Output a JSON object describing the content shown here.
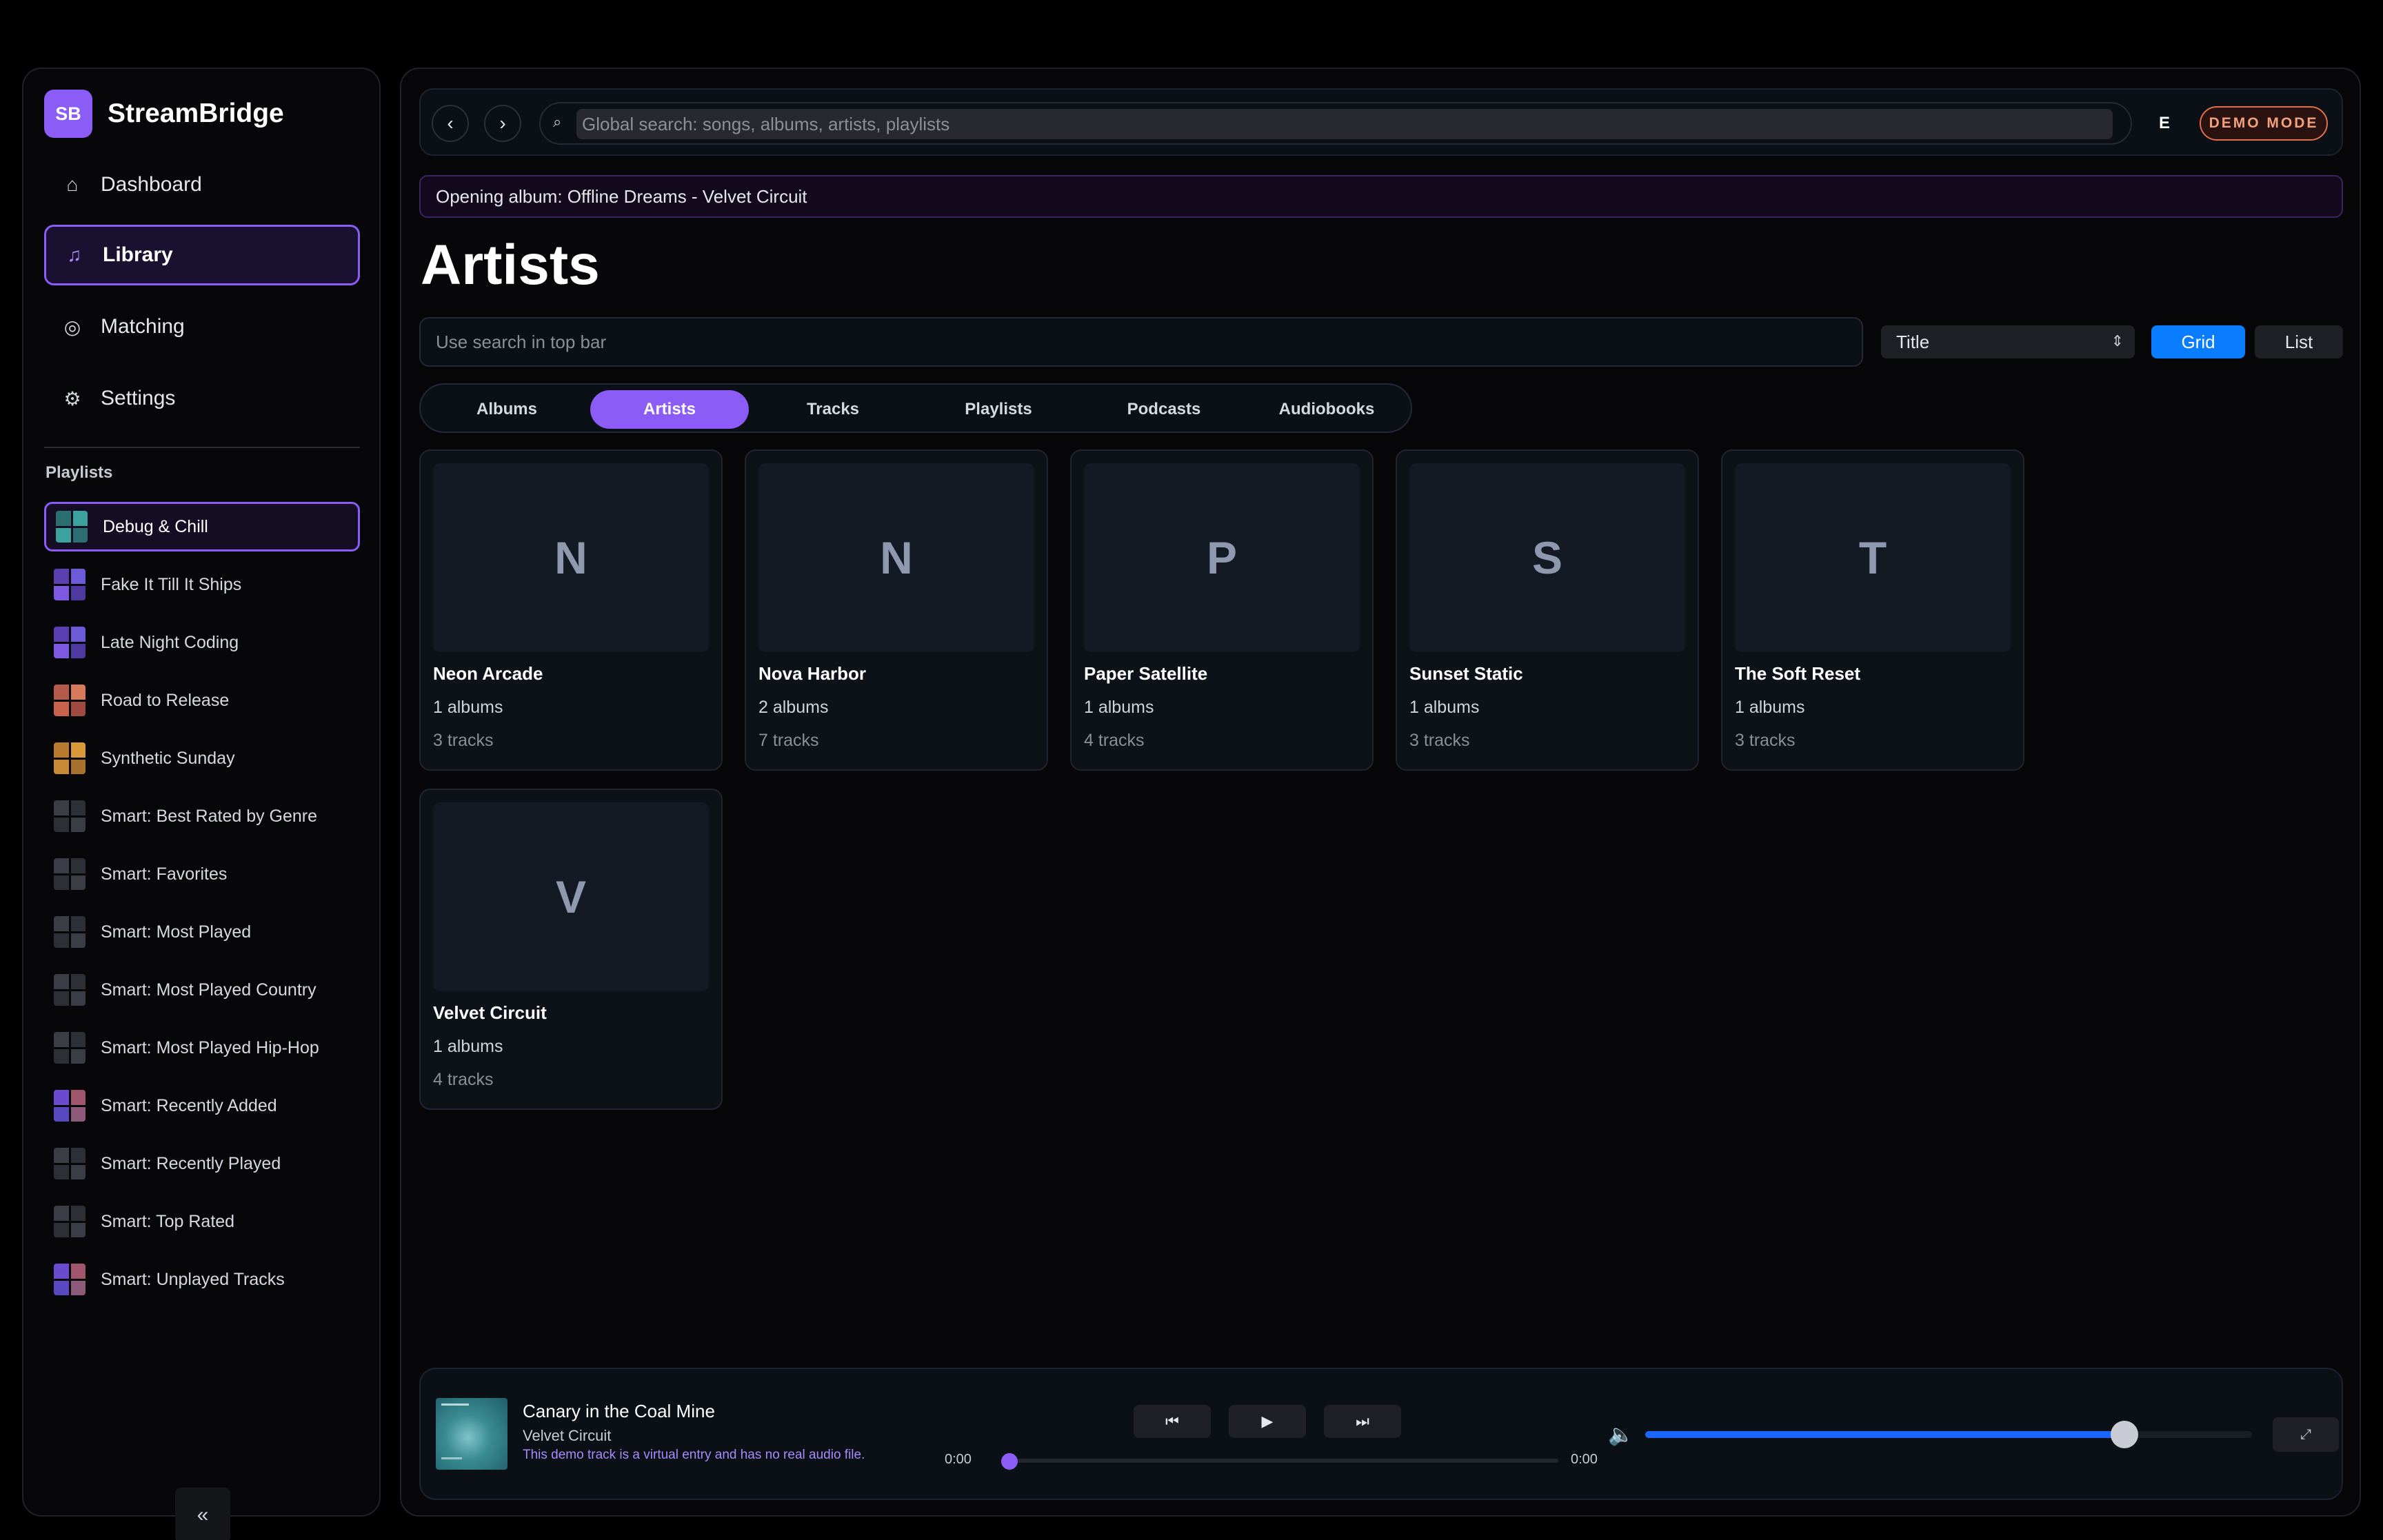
{
  "app": {
    "badge": "SB",
    "name": "StreamBridge"
  },
  "nav": [
    {
      "label": "Dashboard",
      "icon": "home-icon",
      "glyph": "⌂"
    },
    {
      "label": "Library",
      "icon": "music-note-icon",
      "glyph": "♫"
    },
    {
      "label": "Matching",
      "icon": "target-icon",
      "glyph": "◎"
    },
    {
      "label": "Settings",
      "icon": "gear-icon",
      "glyph": "⚙"
    }
  ],
  "playlists_heading": "Playlists",
  "playlists": [
    {
      "label": "Debug & Chill",
      "thumb": "teal"
    },
    {
      "label": "Fake It Till It Ships",
      "thumb": "purple"
    },
    {
      "label": "Late Night Coding",
      "thumb": "purple"
    },
    {
      "label": "Road to Release",
      "thumb": "red"
    },
    {
      "label": "Synthetic Sunday",
      "thumb": "orange"
    },
    {
      "label": "Smart: Best Rated by Genre",
      "thumb": "gray"
    },
    {
      "label": "Smart: Favorites",
      "thumb": "gray"
    },
    {
      "label": "Smart: Most Played",
      "thumb": "gray"
    },
    {
      "label": "Smart: Most Played Country",
      "thumb": "gray"
    },
    {
      "label": "Smart: Most Played Hip-Hop",
      "thumb": "gray"
    },
    {
      "label": "Smart: Recently Added",
      "thumb": "mix"
    },
    {
      "label": "Smart: Recently Played",
      "thumb": "gray"
    },
    {
      "label": "Smart: Top Rated",
      "thumb": "gray"
    },
    {
      "label": "Smart: Unplayed Tracks",
      "thumb": "mix"
    }
  ],
  "sidebar_collapse": "«",
  "topbar": {
    "back": "‹",
    "forward": "›",
    "search_icon": "⌕",
    "search_placeholder": "Global search: songs, albums, artists, playlists",
    "avatar": "E",
    "demo_badge": "DEMO MODE"
  },
  "notice": "Opening album: Offline Dreams - Velvet Circuit",
  "page_title": "Artists",
  "filter_placeholder": "Use search in top bar",
  "sort": {
    "value": "Title",
    "chevron": "⇕"
  },
  "view": {
    "grid": "Grid",
    "list": "List"
  },
  "tabs": [
    "Albums",
    "Artists",
    "Tracks",
    "Playlists",
    "Podcasts",
    "Audiobooks"
  ],
  "active_tab": "Artists",
  "artists": [
    {
      "initial": "N",
      "name": "Neon Arcade",
      "albums": "1 albums",
      "tracks": "3 tracks"
    },
    {
      "initial": "N",
      "name": "Nova Harbor",
      "albums": "2 albums",
      "tracks": "7 tracks"
    },
    {
      "initial": "P",
      "name": "Paper Satellite",
      "albums": "1 albums",
      "tracks": "4 tracks"
    },
    {
      "initial": "S",
      "name": "Sunset Static",
      "albums": "1 albums",
      "tracks": "3 tracks"
    },
    {
      "initial": "T",
      "name": "The Soft Reset",
      "albums": "1 albums",
      "tracks": "3 tracks"
    },
    {
      "initial": "V",
      "name": "Velvet Circuit",
      "albums": "1 albums",
      "tracks": "4 tracks"
    }
  ],
  "player": {
    "title": "Canary in the Coal Mine",
    "artist": "Velvet Circuit",
    "note": "This demo track is a virtual entry and has no real audio file.",
    "prev": "⏮",
    "play": "▶",
    "next": "⏭",
    "time_current": "0:00",
    "time_total": "0:00",
    "progress": 0,
    "volume_icon": "🔈",
    "volume": 0.79,
    "expand": "⤢"
  },
  "colors": {
    "accent": "#8b5cf6",
    "primary_button": "#0a7cff",
    "volume_fill": "#1a66ff",
    "demo_badge": "#e0704a"
  }
}
